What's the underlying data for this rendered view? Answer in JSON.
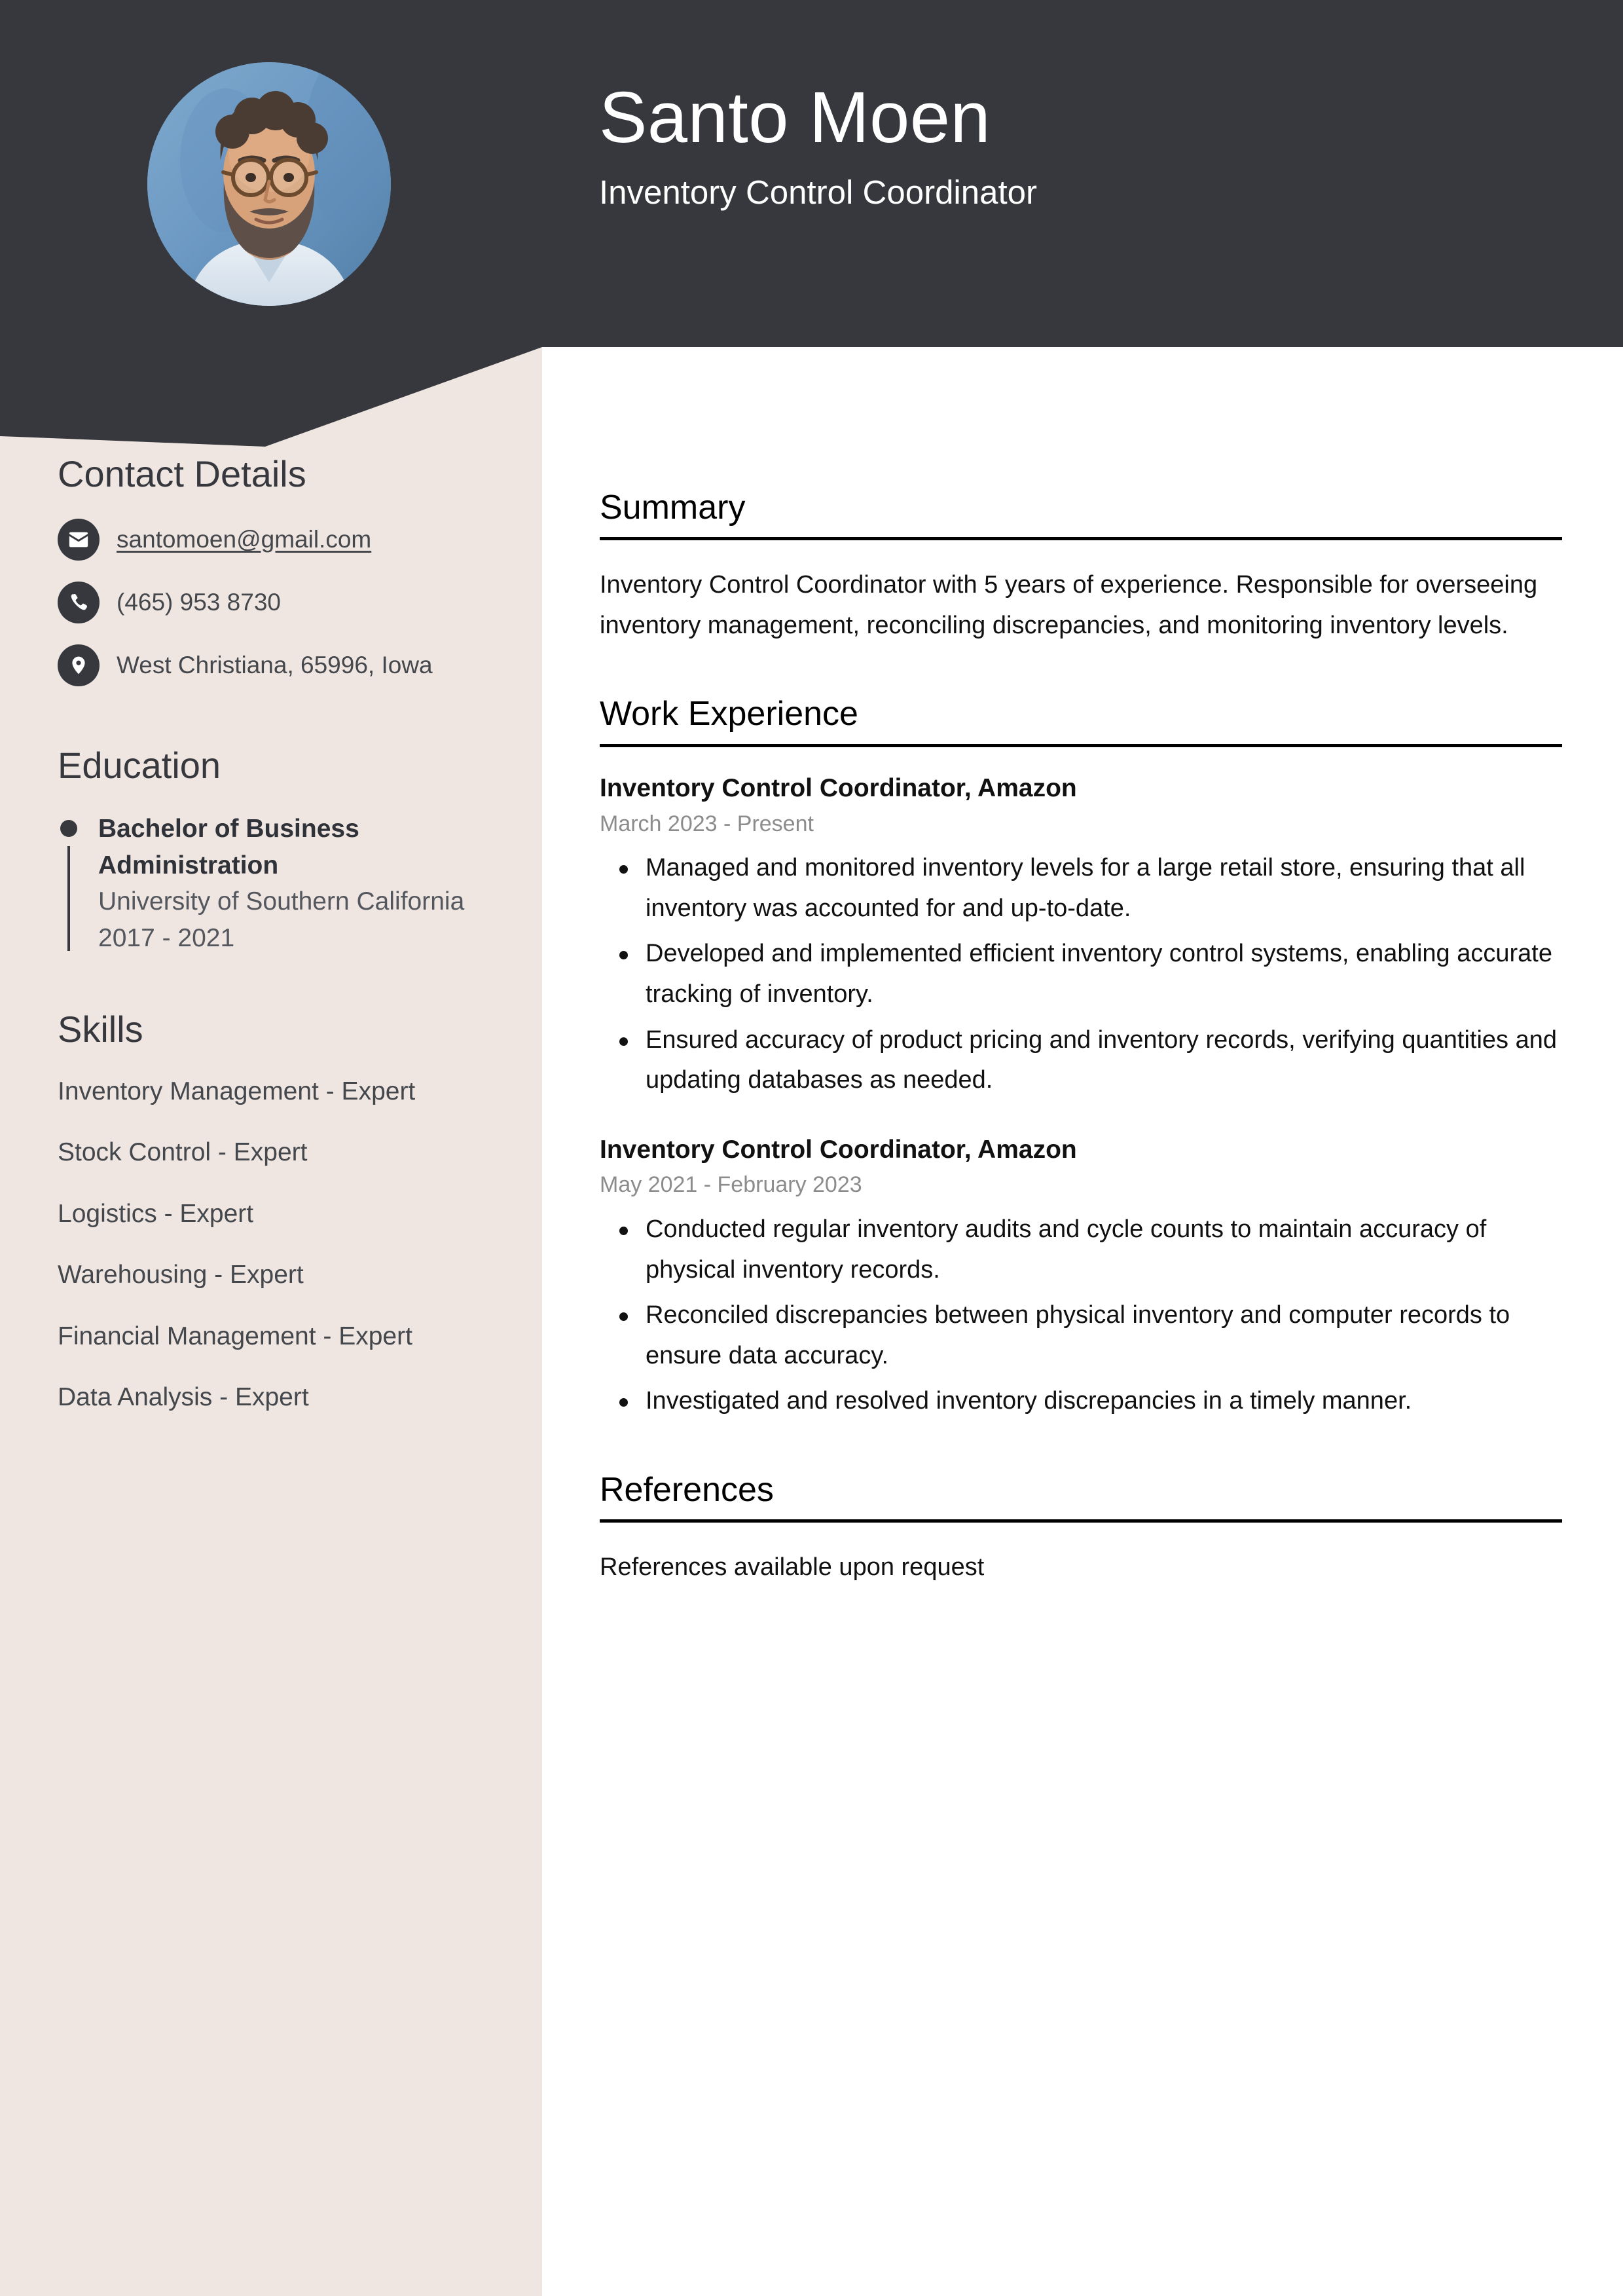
{
  "header": {
    "name": "Santo Moen",
    "job_title": "Inventory Control Coordinator",
    "avatar_alt": "profile-photo",
    "background_color": "#36383D"
  },
  "sidebar": {
    "background_color": "#EFE6E1",
    "contact": {
      "heading": "Contact Details",
      "items": [
        {
          "icon": "envelope-icon",
          "value": "santomoen@gmail.com",
          "is_link": true
        },
        {
          "icon": "phone-icon",
          "value": "(465) 953 8730",
          "is_link": false
        },
        {
          "icon": "location-pin-icon",
          "value": "West Christiana, 65996, Iowa",
          "is_link": false
        }
      ]
    },
    "education": {
      "heading": "Education",
      "items": [
        {
          "degree": "Bachelor of Business Administration",
          "school": "University of Southern California",
          "dates": "2017 - 2021"
        }
      ]
    },
    "skills": {
      "heading": "Skills",
      "items": [
        "Inventory Management - Expert",
        "Stock Control - Expert",
        "Logistics - Expert",
        "Warehousing - Expert",
        "Financial Management - Expert",
        "Data Analysis - Expert"
      ]
    }
  },
  "main": {
    "summary": {
      "heading": "Summary",
      "text": "Inventory Control Coordinator with 5 years of experience. Responsible for overseeing inventory management, reconciling discrepancies, and monitoring inventory levels."
    },
    "work_experience": {
      "heading": "Work Experience",
      "jobs": [
        {
          "title": "Inventory Control Coordinator, Amazon",
          "dates": "March 2023 - Present",
          "bullets": [
            "Managed and monitored inventory levels for a large retail store, ensuring that all inventory was accounted for and up-to-date.",
            "Developed and implemented efficient inventory control systems, enabling accurate tracking of inventory.",
            "Ensured accuracy of product pricing and inventory records, verifying quantities and updating databases as needed."
          ]
        },
        {
          "title": "Inventory Control Coordinator, Amazon",
          "dates": "May 2021 - February 2023",
          "bullets": [
            "Conducted regular inventory audits and cycle counts to maintain accuracy of physical inventory records.",
            "Reconciled discrepancies between physical inventory and computer records to ensure data accuracy.",
            "Investigated and resolved inventory discrepancies in a timely manner."
          ]
        }
      ]
    },
    "references": {
      "heading": "References",
      "text": "References available upon request"
    }
  }
}
